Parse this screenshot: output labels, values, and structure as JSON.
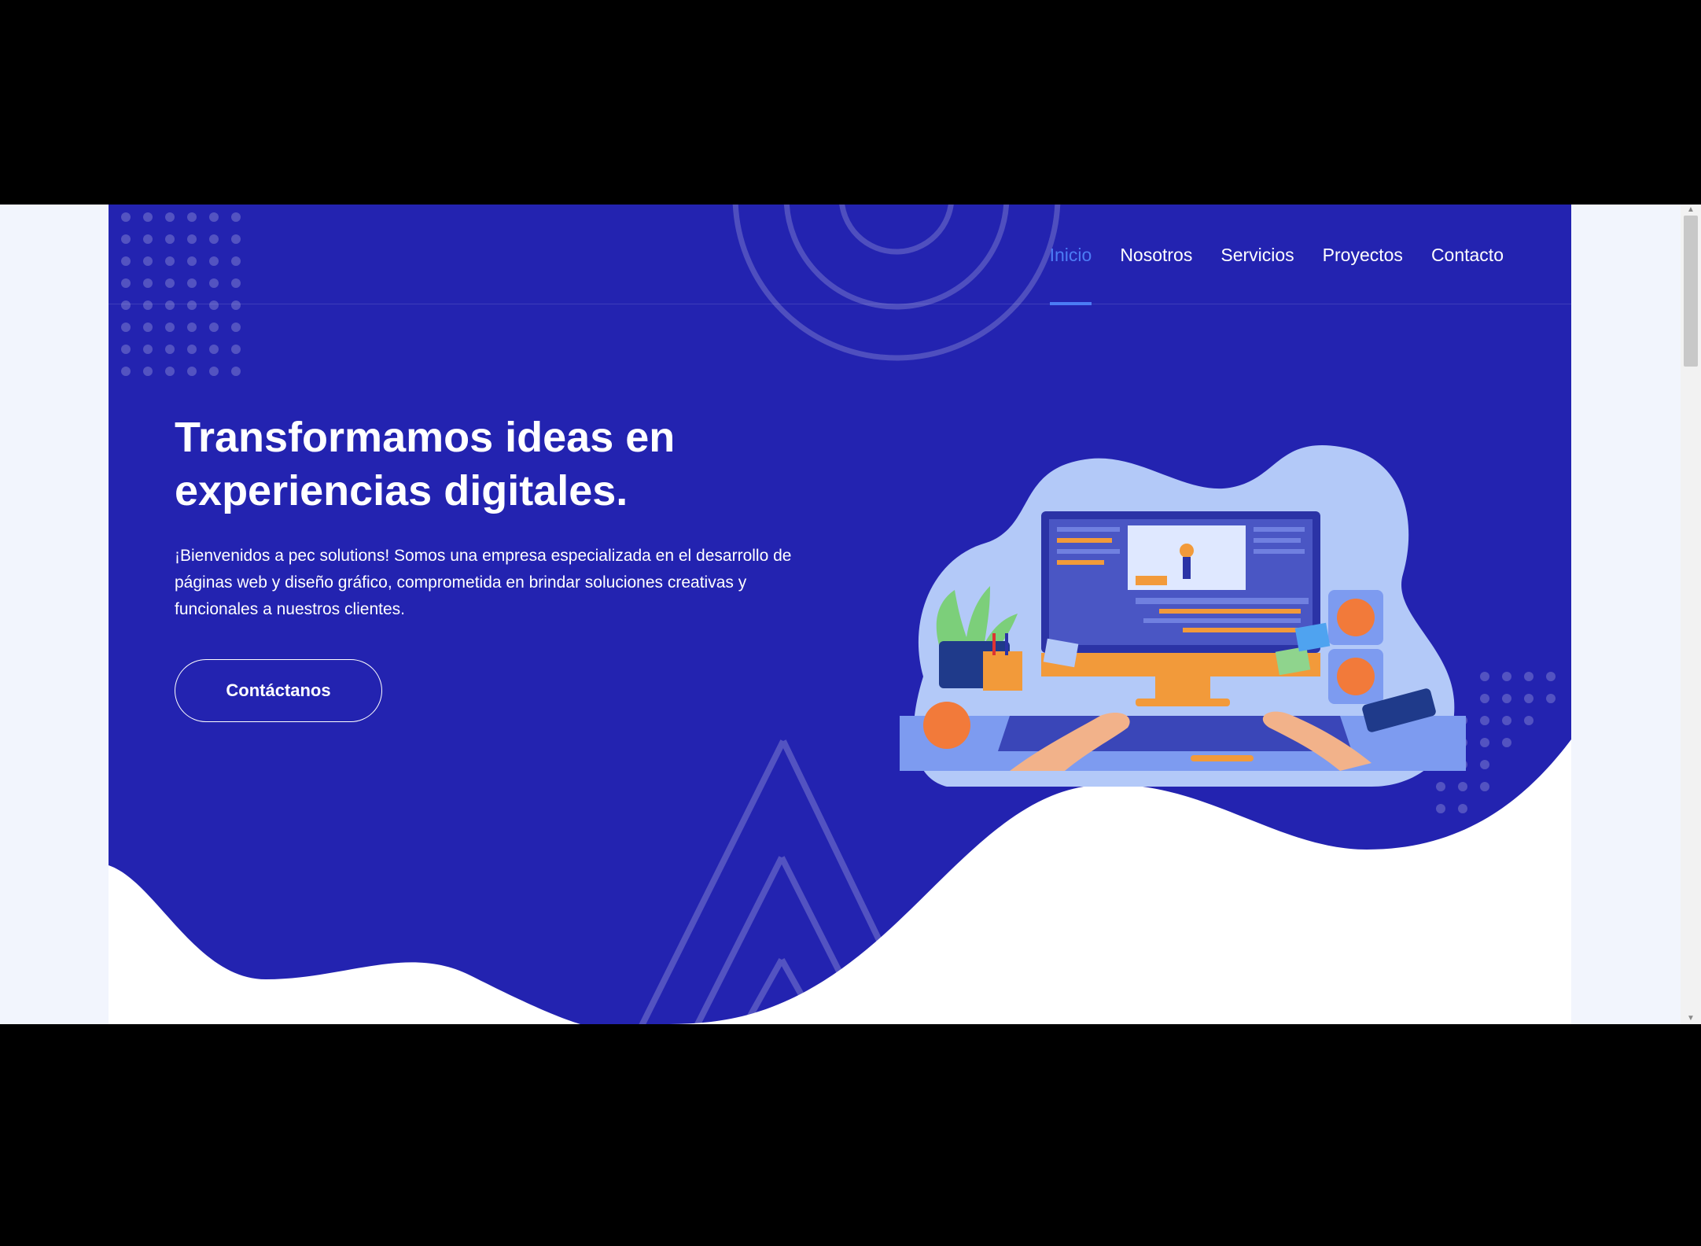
{
  "nav": {
    "items": [
      {
        "label": "Inicio",
        "active": true
      },
      {
        "label": "Nosotros",
        "active": false
      },
      {
        "label": "Servicios",
        "active": false
      },
      {
        "label": "Proyectos",
        "active": false
      },
      {
        "label": "Contacto",
        "active": false
      }
    ]
  },
  "hero": {
    "title_line1": "Transformamos ideas en",
    "title_line2": "experiencias digitales.",
    "text": "¡Bienvenidos a pec solutions! Somos una empresa especializada en el desarrollo de páginas web y diseño gráfico, comprometida en brindar soluciones creativas y funcionales a nuestros clientes.",
    "cta_label": "Contáctanos"
  },
  "colors": {
    "hero_blue": "#2323b0",
    "accent": "#4c7cf5",
    "page_bg": "#f2f5fd"
  },
  "icons": {
    "illustration": "developer-workstation-illustration",
    "scroll_up": "scroll-up-arrow",
    "scroll_down": "scroll-down-arrow"
  }
}
